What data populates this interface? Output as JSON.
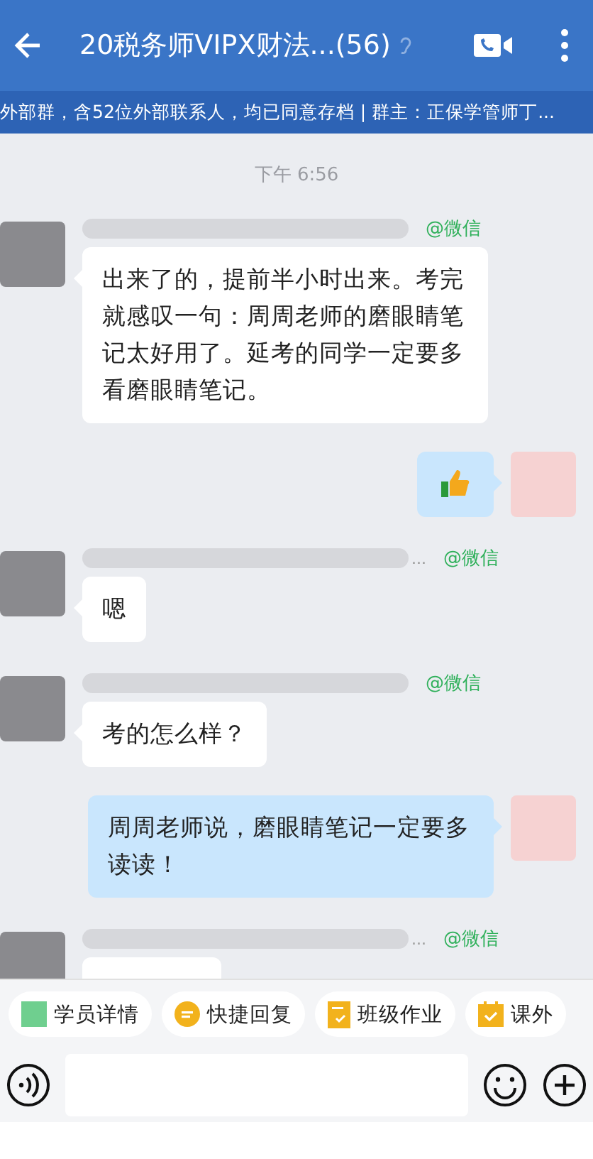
{
  "header": {
    "title": "20税务师VIPX财法...(56)",
    "subtitle": "外部群，含52位外部联系人，均已同意存档 | 群主：正保学管师丁..."
  },
  "time": "下午 6:56",
  "messages": [
    {
      "kind": "in",
      "source": "@微信",
      "text": "出来了的，提前半小时出来。考完就感叹一句：周周老师的磨眼睛笔记太好用了。延考的同学一定要多看磨眼睛笔记。"
    },
    {
      "kind": "thumb"
    },
    {
      "kind": "in",
      "source": "@微信",
      "name_suffix": "...",
      "text": "嗯"
    },
    {
      "kind": "in",
      "source": "@微信",
      "text": "考的怎么样？"
    },
    {
      "kind": "out",
      "text": "周周老师说，磨眼睛笔记一定要多读读！"
    },
    {
      "kind": "in",
      "source": "@微信",
      "name_suffix": "..."
    }
  ],
  "chips": [
    {
      "kind": "student",
      "label": "学员详情"
    },
    {
      "kind": "reply",
      "label": "快捷回复"
    },
    {
      "kind": "homework",
      "label": "班级作业"
    },
    {
      "kind": "calendar",
      "label": "课外"
    }
  ]
}
